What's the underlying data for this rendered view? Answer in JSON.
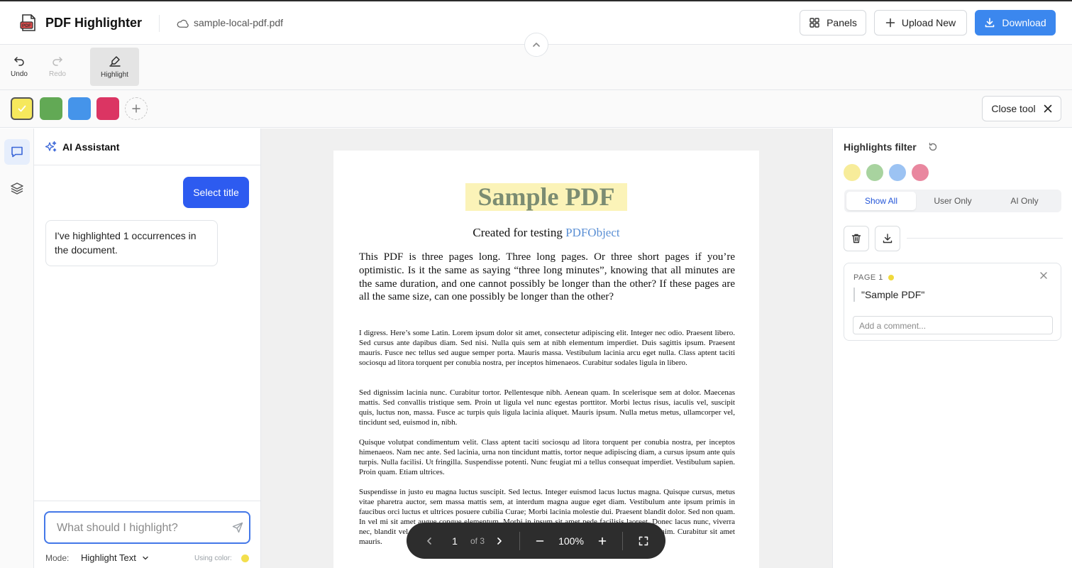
{
  "header": {
    "app_title": "PDF Highlighter",
    "filename": "sample-local-pdf.pdf",
    "panels_label": "Panels",
    "upload_label": "Upload New",
    "download_label": "Download",
    "logo_text": "PDF"
  },
  "toolbar": {
    "undo_label": "Undo",
    "redo_label": "Redo",
    "highlight_label": "Highlight"
  },
  "colors": {
    "swatches": [
      "#f6e85c",
      "#62a955",
      "#4594ea",
      "#db3563"
    ],
    "selected_index": 0,
    "close_tool_label": "Close tool"
  },
  "sidebar": {
    "items": [
      {
        "icon": "chat-icon",
        "active": true
      },
      {
        "icon": "layers-icon",
        "active": false
      }
    ]
  },
  "ai_panel": {
    "title": "AI Assistant",
    "messages": [
      {
        "role": "user",
        "text": "Select title"
      },
      {
        "role": "assistant",
        "text": "I've highlighted 1 occurrences in the document."
      }
    ],
    "input_placeholder": "What should I highlight?",
    "mode_label": "Mode:",
    "mode_value": "Highlight Text",
    "using_color_label": "Using color:",
    "using_color": "#f3df4d"
  },
  "document": {
    "title": "Sample PDF",
    "subtitle_prefix": "Created for testing",
    "subtitle_link": "PDFObject",
    "lead": "This PDF is three pages long. Three long pages. Or three short pages if you’re optimistic. Is it the same as saying “three long minutes”, knowing that all minutes are the same duration, and one cannot possibly be longer than the other? If these pages are all the same size, can one possibly be longer than the other?",
    "paragraphs": [
      "I digress. Here’s some Latin. Lorem ipsum dolor sit amet, consectetur adipiscing elit. Integer nec odio. Praesent libero. Sed cursus ante dapibus diam. Sed nisi. Nulla quis sem at nibh elementum imperdiet. Duis sagittis ipsum. Praesent mauris. Fusce nec tellus sed augue semper porta. Mauris massa. Vestibulum lacinia arcu eget nulla. Class aptent taciti sociosqu ad litora torquent per conubia nostra, per inceptos himenaeos. Curabitur sodales ligula in libero.",
      "Sed dignissim lacinia nunc. Curabitur tortor. Pellentesque nibh. Aenean quam. In scelerisque sem at dolor. Maecenas mattis. Sed convallis tristique sem. Proin ut ligula vel nunc egestas porttitor. Morbi lectus risus, iaculis vel, suscipit quis, luctus non, massa. Fusce ac turpis quis ligula lacinia aliquet. Mauris ipsum. Nulla metus metus, ullamcorper vel, tincidunt sed, euismod in, nibh.",
      "Quisque volutpat condimentum velit. Class aptent taciti sociosqu ad litora torquent per conubia nostra, per inceptos himenaeos. Nam nec ante. Sed lacinia, urna non tincidunt mattis, tortor neque adipiscing diam, a cursus ipsum ante quis turpis. Nulla facilisi. Ut fringilla. Suspendisse potenti. Nunc feugiat mi a tellus consequat imperdiet. Vestibulum sapien. Proin quam. Etiam ultrices.",
      "Suspendisse in justo eu magna luctus suscipit. Sed lectus. Integer euismod lacus luctus magna. Quisque cursus, metus vitae pharetra auctor, sem massa mattis sem, at interdum magna augue eget diam. Vestibulum ante ipsum primis in faucibus orci luctus et ultrices posuere cubilia Curae; Morbi lacinia molestie dui. Praesent blandit dolor. Sed non quam. In vel mi sit amet augue congue elementum. Morbi in ipsum sit amet pede facilisis laoreet. Donec lacus nunc, viverra nec, blandit vel, egestas et, augue. Vestibulum tincidunt malesuada tellus. Ut ultrices ultrices enim. Curabitur sit amet mauris."
    ]
  },
  "pager": {
    "current_page": "1",
    "of_label": "of 3",
    "zoom": "100%"
  },
  "highlights": {
    "filter_title": "Highlights filter",
    "filter_colors": [
      "#f7ec9a",
      "#a8d39f",
      "#9cc3f3",
      "#e9879f"
    ],
    "tabs": [
      "Show All",
      "User Only",
      "AI Only"
    ],
    "active_tab": 0,
    "items": [
      {
        "page_label": "PAGE 1",
        "color": "#f0d93c",
        "quote": "\"Sample PDF\"",
        "comment_placeholder": "Add a comment..."
      }
    ]
  }
}
